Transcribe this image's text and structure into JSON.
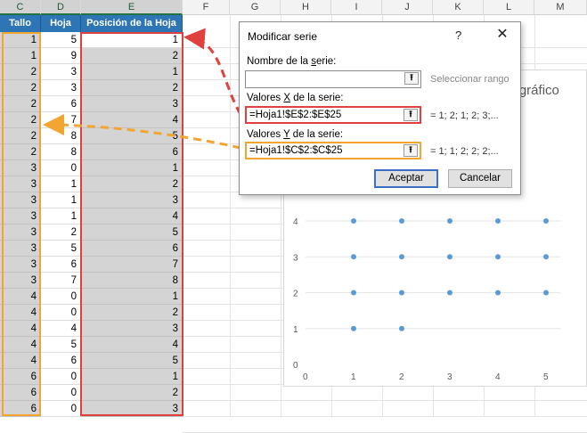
{
  "columns": [
    "C",
    "D",
    "E",
    "F",
    "G",
    "H",
    "I",
    "J",
    "K",
    "L",
    "M"
  ],
  "table": {
    "headers": {
      "tallo": "Tallo",
      "hoja": "Hoja",
      "posicion": "Posición de la Hoja"
    },
    "rows": [
      [
        1,
        5,
        1
      ],
      [
        1,
        9,
        2
      ],
      [
        2,
        3,
        1
      ],
      [
        2,
        3,
        2
      ],
      [
        2,
        6,
        3
      ],
      [
        2,
        7,
        4
      ],
      [
        2,
        8,
        5
      ],
      [
        2,
        8,
        6
      ],
      [
        3,
        0,
        1
      ],
      [
        3,
        1,
        2
      ],
      [
        3,
        1,
        3
      ],
      [
        3,
        1,
        4
      ],
      [
        3,
        2,
        5
      ],
      [
        3,
        5,
        6
      ],
      [
        3,
        6,
        7
      ],
      [
        3,
        7,
        8
      ],
      [
        4,
        0,
        1
      ],
      [
        4,
        0,
        2
      ],
      [
        4,
        4,
        3
      ],
      [
        4,
        5,
        4
      ],
      [
        4,
        6,
        5
      ],
      [
        6,
        0,
        1
      ],
      [
        6,
        0,
        2
      ],
      [
        6,
        0,
        3
      ]
    ]
  },
  "chart": {
    "title_fragment": "el gráfico"
  },
  "chart_data": {
    "type": "scatter",
    "title": "",
    "xlim": [
      0,
      5
    ],
    "ylim": [
      0,
      4
    ],
    "x_ticks": [
      "0",
      "1",
      "2",
      "3",
      "4",
      "5"
    ],
    "y_ticks": [
      "0",
      "1",
      "2",
      "3",
      "4"
    ],
    "points": [
      [
        1,
        4
      ],
      [
        2,
        4
      ],
      [
        3,
        4
      ],
      [
        4,
        4
      ],
      [
        5,
        4
      ],
      [
        1,
        3
      ],
      [
        2,
        3
      ],
      [
        3,
        3
      ],
      [
        4,
        3
      ],
      [
        5,
        3
      ],
      [
        1,
        2
      ],
      [
        2,
        2
      ],
      [
        3,
        2
      ],
      [
        4,
        2
      ],
      [
        5,
        2
      ],
      [
        1,
        1
      ],
      [
        2,
        1
      ]
    ],
    "color": "#5b9bd5"
  },
  "dialog": {
    "title": "Modificar serie",
    "help": "?",
    "close": "✕",
    "name_label": "Nombre de la serie:",
    "name_value": "",
    "name_side": "Seleccionar rango",
    "x_label": "Valores X de la serie:",
    "x_value": "=Hoja1!$E$2:$E$25",
    "x_side": "= 1; 2; 1; 2; 3;...",
    "y_label": "Valores Y de la serie:",
    "y_value": "=Hoja1!$C$2:$C$25",
    "y_side": "= 1; 1; 2; 2; 2;...",
    "ok": "Aceptar",
    "cancel": "Cancelar"
  },
  "colors": {
    "header_blue": "#2e75b6",
    "orange": "#f2a531",
    "red": "#e0403e",
    "cell_gray": "#d4d4d4"
  }
}
